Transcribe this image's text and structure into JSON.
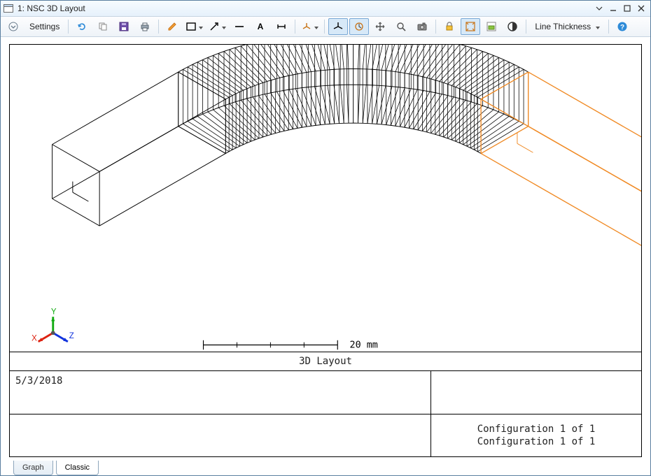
{
  "window": {
    "title": "1: NSC 3D Layout"
  },
  "toolbar": {
    "settings_label": "Settings",
    "line_thickness_label": "Line Thickness"
  },
  "viewport": {
    "scale_label": "20 mm",
    "axis_x": "X",
    "axis_y": "Y",
    "axis_z": "Z"
  },
  "plate": {
    "header": "3D Layout",
    "date": "5/3/2018",
    "config_line1": "Configuration 1 of 1",
    "config_line2": "Configuration 1 of 1"
  },
  "tabs": {
    "graph": "Graph",
    "classic": "Classic"
  },
  "colors": {
    "accent_orange": "#f08a24",
    "grid_black": "#000000"
  }
}
